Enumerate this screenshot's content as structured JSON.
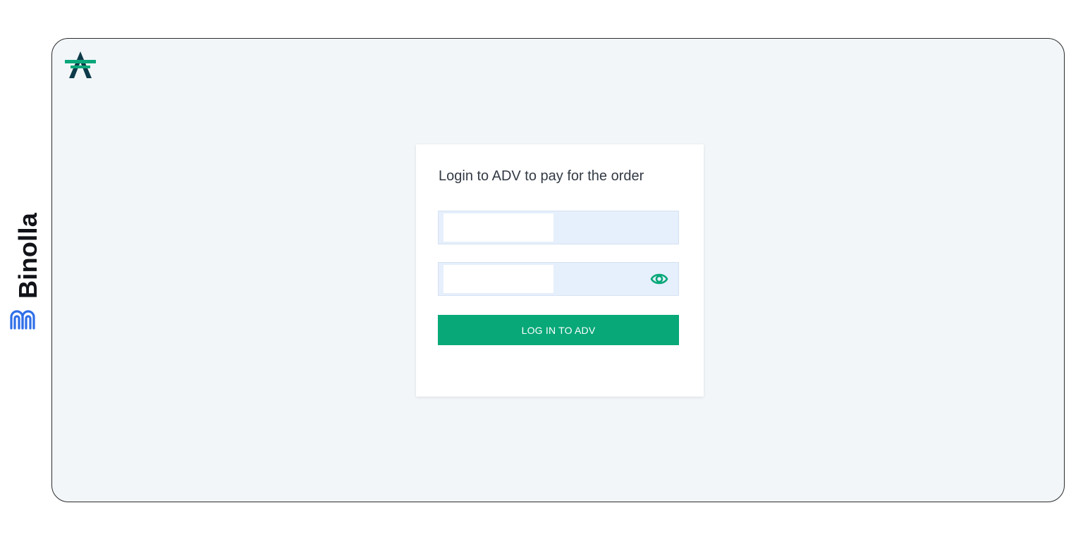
{
  "brand": {
    "name": "Binolla",
    "logo_icon": "binolla-logo-icon",
    "color": "#111318",
    "logo_color": "#2f6fe8"
  },
  "frame": {
    "logo_icon": "adv-logo-icon",
    "background": "#f2f6f9"
  },
  "login_card": {
    "title": "Login to ADV to pay for the order",
    "email_field": {
      "value": "",
      "placeholder": ""
    },
    "password_field": {
      "value": "",
      "placeholder": "",
      "toggle_icon": "eye-icon"
    },
    "submit_label": "LOG IN TO ADV",
    "accent_color": "#08a878"
  }
}
